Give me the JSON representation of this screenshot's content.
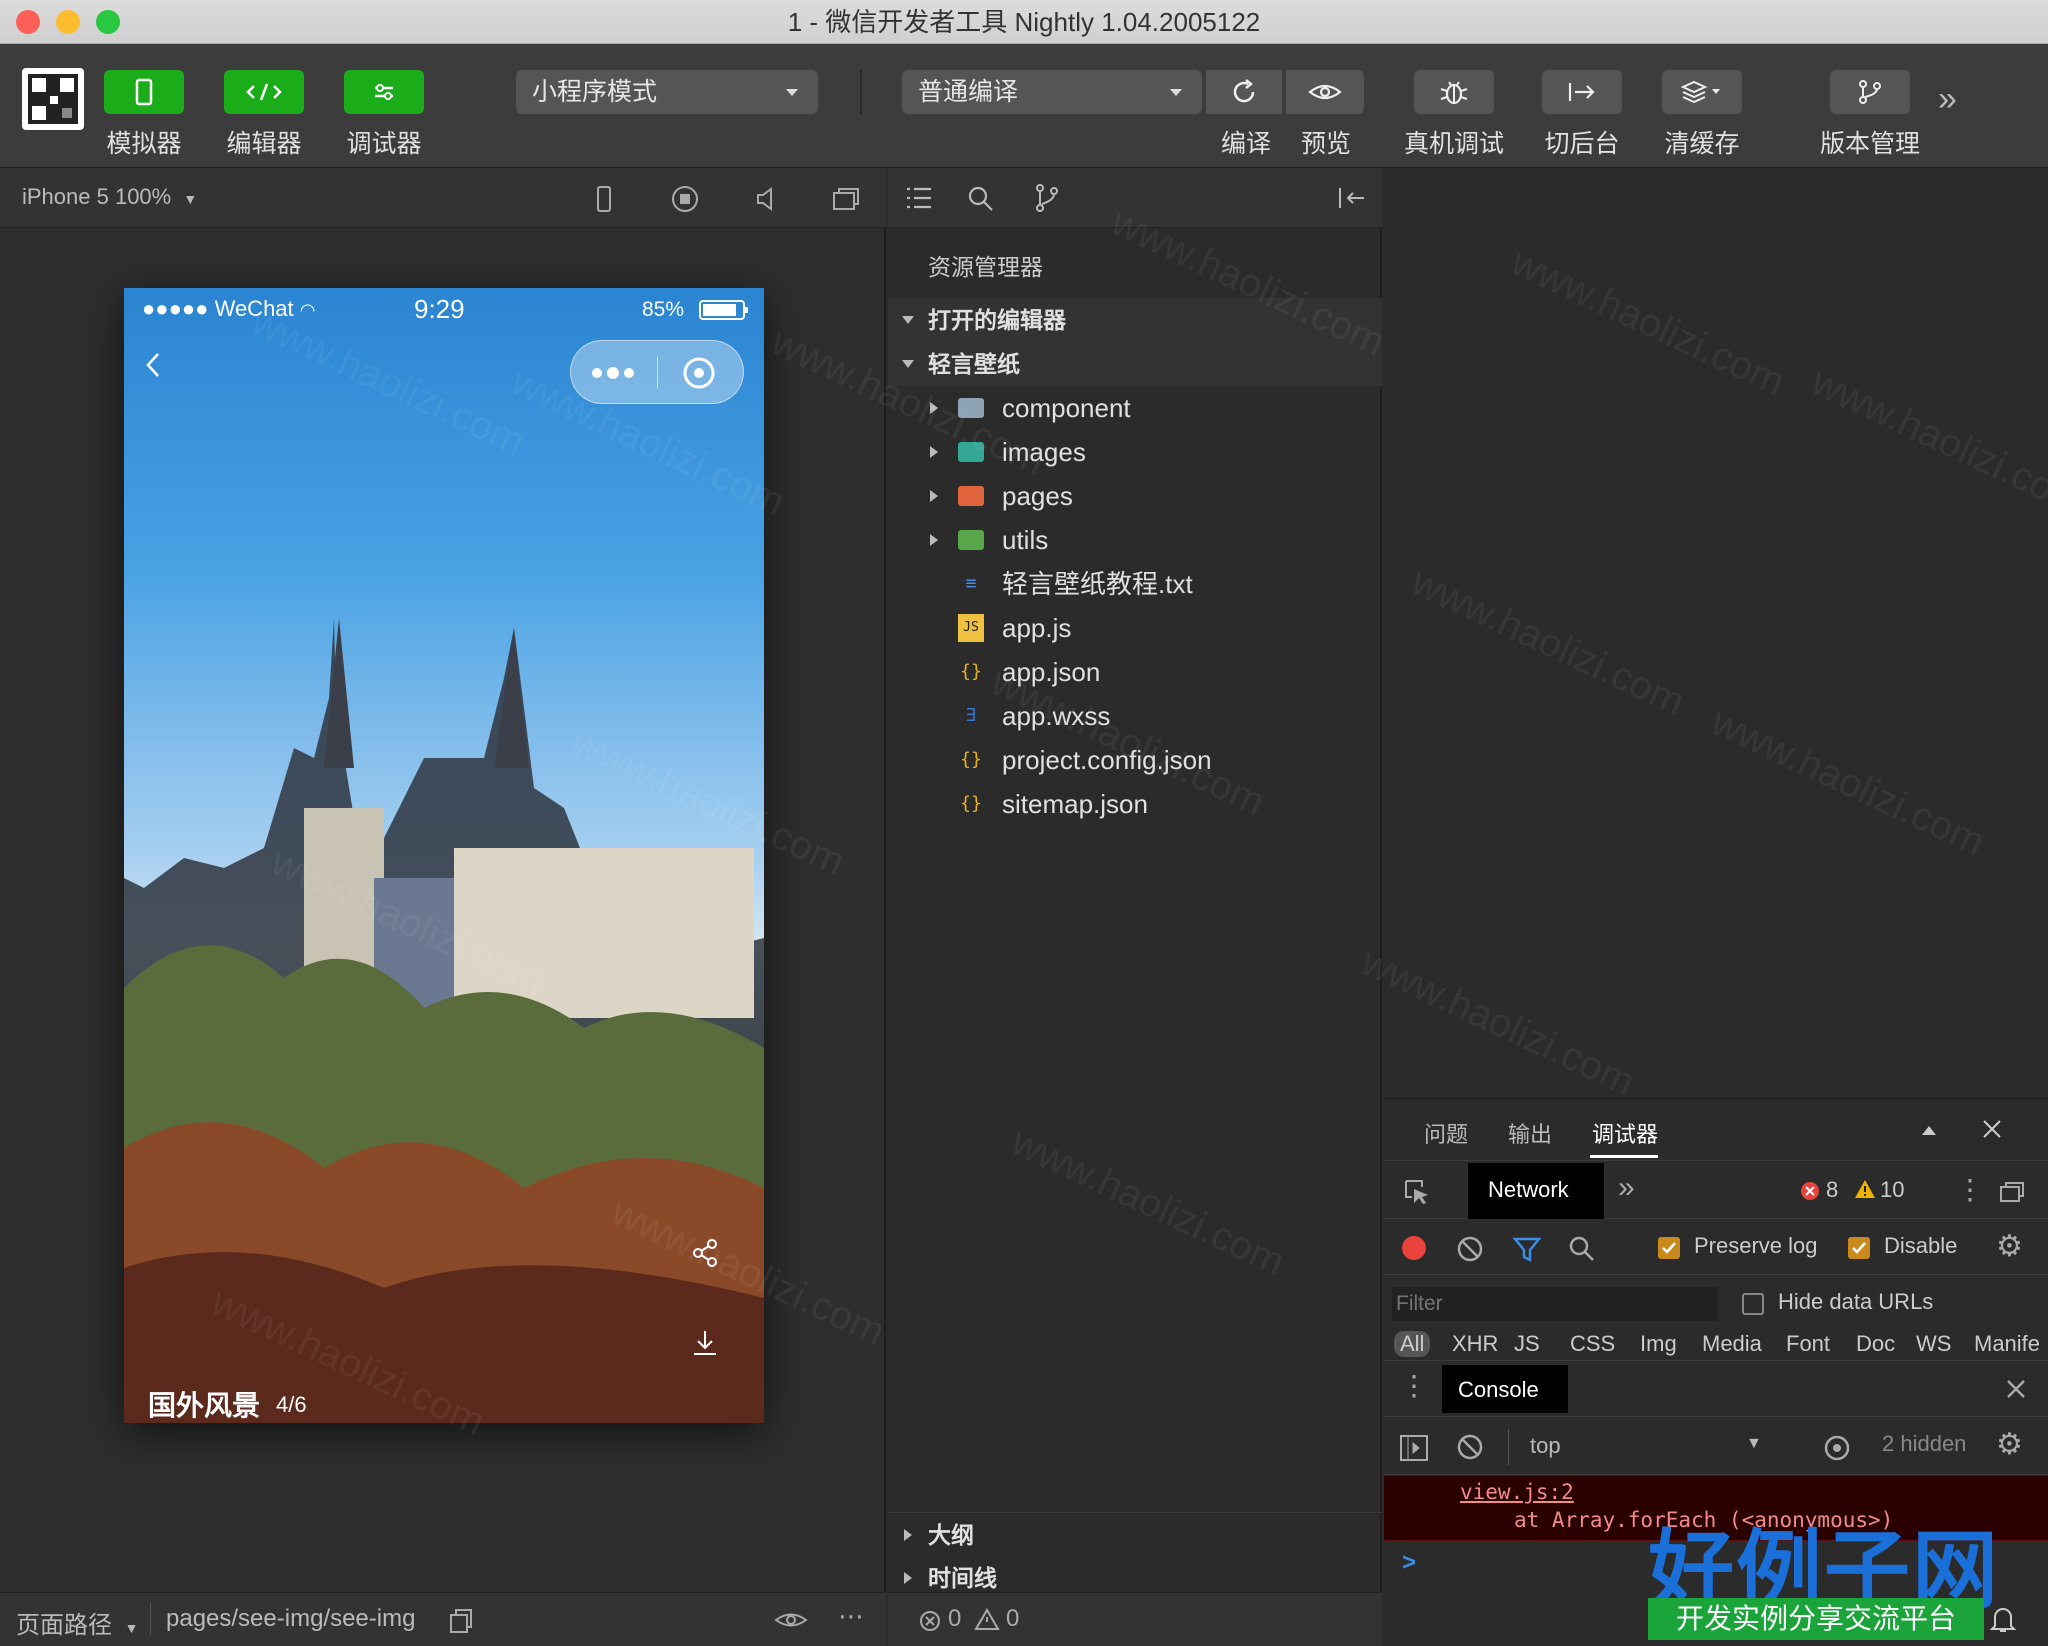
{
  "window": {
    "title": "1 - 微信开发者工具 Nightly 1.04.2005122"
  },
  "toolbar": {
    "simulator_label": "模拟器",
    "editor_label": "编辑器",
    "debugger_label": "调试器",
    "mode_select": "小程序模式",
    "compile_select": "普通编译",
    "compile_label": "编译",
    "preview_label": "预览",
    "real_debug_label": "真机调试",
    "background_label": "切后台",
    "clear_cache_label": "清缓存",
    "version_label": "版本管理"
  },
  "simulator": {
    "device": "iPhone 5 100%",
    "status": {
      "signal": "●●●●●",
      "carrier": "WeChat",
      "time": "9:29",
      "battery": "85%"
    },
    "caption": "国外风景",
    "counter": "4/6"
  },
  "explorer": {
    "title": "资源管理器",
    "open_editors": "打开的编辑器",
    "project": "轻言壁纸",
    "items": [
      {
        "name": "component",
        "type": "folder",
        "color": "#8ea3b5"
      },
      {
        "name": "images",
        "type": "folder",
        "color": "#33a896"
      },
      {
        "name": "pages",
        "type": "folder",
        "color": "#e0643c"
      },
      {
        "name": "utils",
        "type": "folder",
        "color": "#57a64a"
      },
      {
        "name": "轻言壁纸教程.txt",
        "type": "txt"
      },
      {
        "name": "app.js",
        "type": "js"
      },
      {
        "name": "app.json",
        "type": "json"
      },
      {
        "name": "app.wxss",
        "type": "wxss"
      },
      {
        "name": "project.config.json",
        "type": "json"
      },
      {
        "name": "sitemap.json",
        "type": "json"
      }
    ],
    "outline": "大纲",
    "timeline": "时间线",
    "errors": "0",
    "warnings": "0"
  },
  "devtools": {
    "tabs": [
      "问题",
      "输出",
      "调试器"
    ],
    "network_tab": "Network",
    "error_count": "8",
    "warning_count": "10",
    "preserve_log": "Preserve log",
    "disable_cache": "Disable",
    "filter_placeholder": "Filter",
    "hide_data_urls": "Hide data URLs",
    "types": [
      "All",
      "XHR",
      "JS",
      "CSS",
      "Img",
      "Media",
      "Font",
      "Doc",
      "WS",
      "Manife"
    ],
    "console_tab": "Console",
    "context": "top",
    "hidden": "2 hidden",
    "log_line1": "view.js:2",
    "log_line2": "at Array.forEach (<anonymous>)",
    "prompt": ">"
  },
  "statusbar": {
    "path_label": "页面路径",
    "path": "pages/see-img/see-img"
  },
  "watermark": {
    "site": "www.haolizi.com",
    "brand": "好例子网",
    "brand_sub": "开发实例分享交流平台"
  }
}
